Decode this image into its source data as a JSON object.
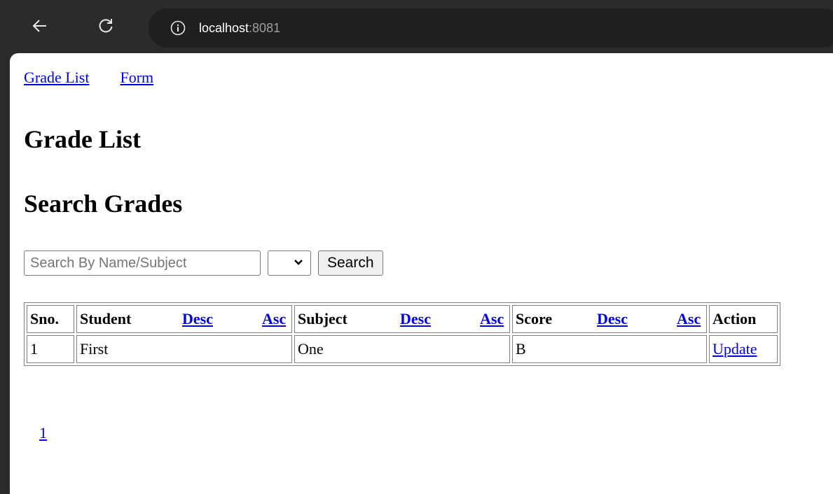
{
  "browser": {
    "url_host": "localhost",
    "url_port": ":8081"
  },
  "nav": {
    "grade_list": "Grade List",
    "form": "Form"
  },
  "headings": {
    "grade_list": "Grade List",
    "search_grades": "Search Grades"
  },
  "search": {
    "placeholder": "Search By Name/Subject",
    "value": "",
    "select_value": "",
    "button": "Search"
  },
  "table": {
    "headers": {
      "sno": "Sno.",
      "student": "Student",
      "subject": "Subject",
      "score": "Score",
      "action": "Action",
      "desc": "Desc",
      "asc": "Asc"
    },
    "rows": [
      {
        "sno": "1",
        "student": "First",
        "subject": "One",
        "score": "B",
        "action": "Update"
      }
    ]
  },
  "pagination": {
    "pages": [
      "1"
    ]
  },
  "colors": {
    "link": "#0000ee",
    "chrome_bg": "#2b2b2b",
    "omnibox_bg": "#1f1f1f"
  }
}
